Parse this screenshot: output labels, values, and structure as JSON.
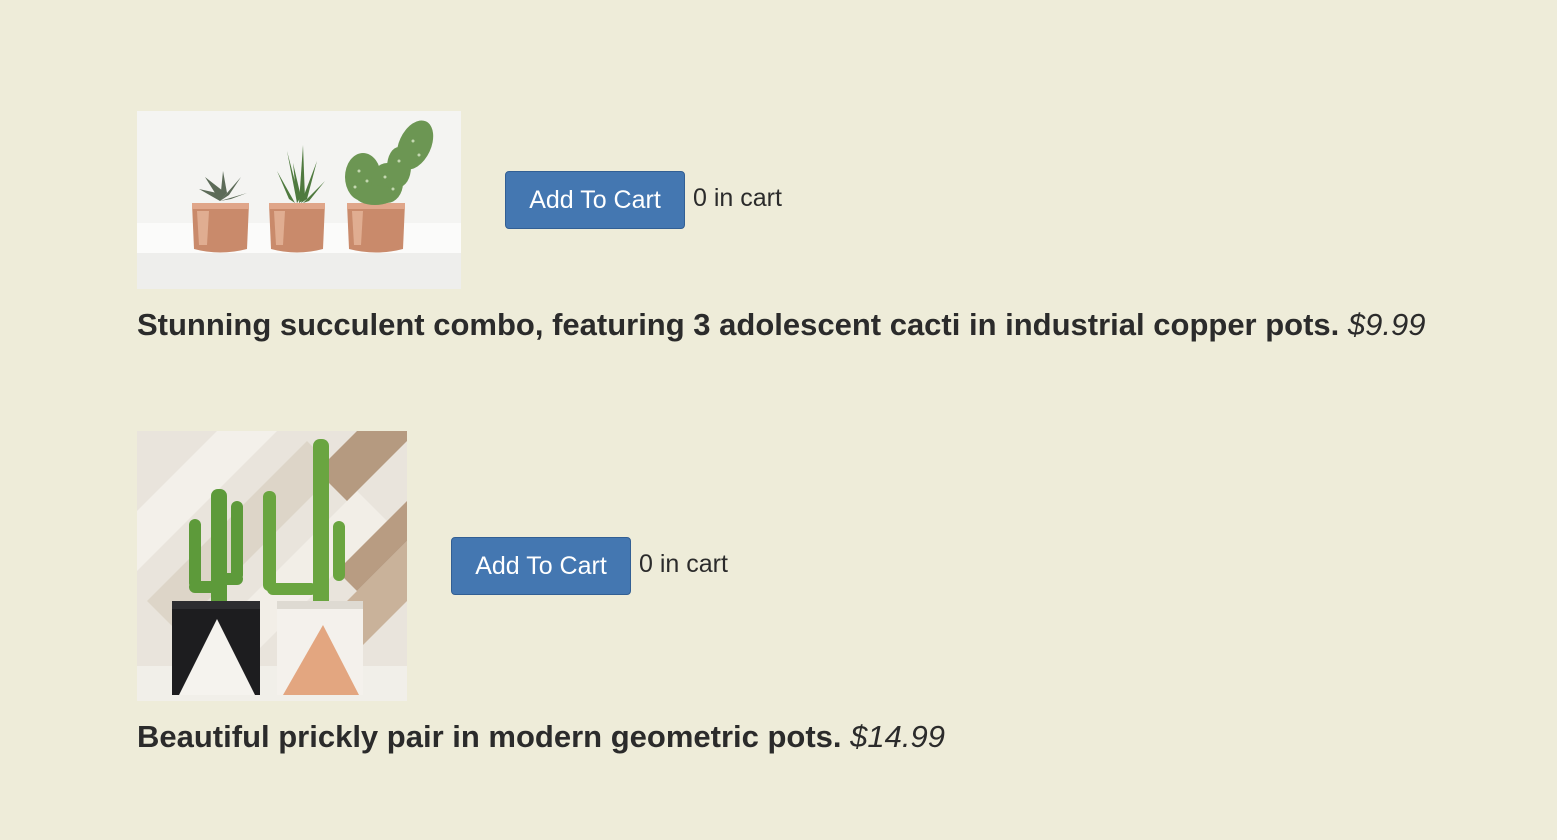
{
  "products": [
    {
      "description": "Stunning succulent combo, featuring 3 adolescent cacti in industrial copper pots.",
      "price": "$9.99",
      "button_label": "Add To Cart",
      "cart_count_text": "0 in cart",
      "image_icon": "succulent-trio-copper-pots-photo"
    },
    {
      "description": "Beautiful prickly pair in modern geometric pots.",
      "price": "$14.99",
      "button_label": "Add To Cart",
      "cart_count_text": "0 in cart",
      "image_icon": "cactus-pair-geometric-pots-photo"
    }
  ],
  "colors": {
    "background": "#eeecd9",
    "button": "#4477b1",
    "text": "#2b2b2b"
  }
}
